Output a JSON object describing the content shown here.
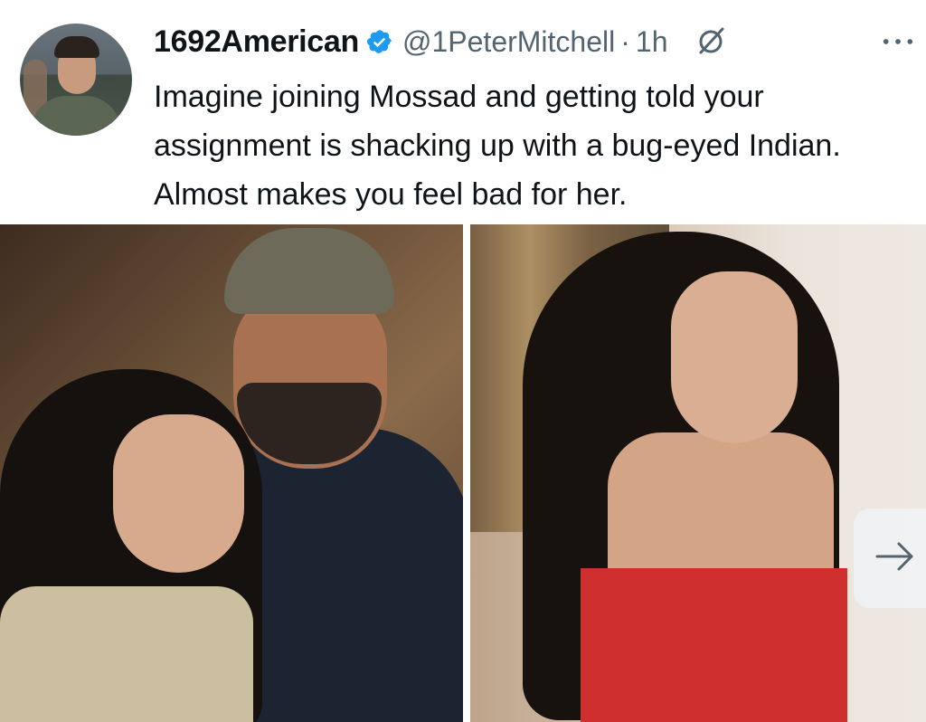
{
  "post": {
    "author": {
      "display_name": "1692American",
      "handle": "@1PeterMitchell",
      "separator": "·",
      "time": "1h",
      "verified": true,
      "verified_color": "#1d9bf0"
    },
    "text": "Imagine joining Mossad and getting told your assignment is shacking up with a bug-eyed Indian. Almost makes you feel bad for her.",
    "media": {
      "images": [
        {
          "alt_icon": "photo-couple"
        },
        {
          "alt_icon": "photo-woman-red-dress"
        }
      ],
      "next_icon": "arrow-right-icon"
    },
    "more_icon": "ellipsis-icon",
    "grok_icon": "grok-icon"
  }
}
